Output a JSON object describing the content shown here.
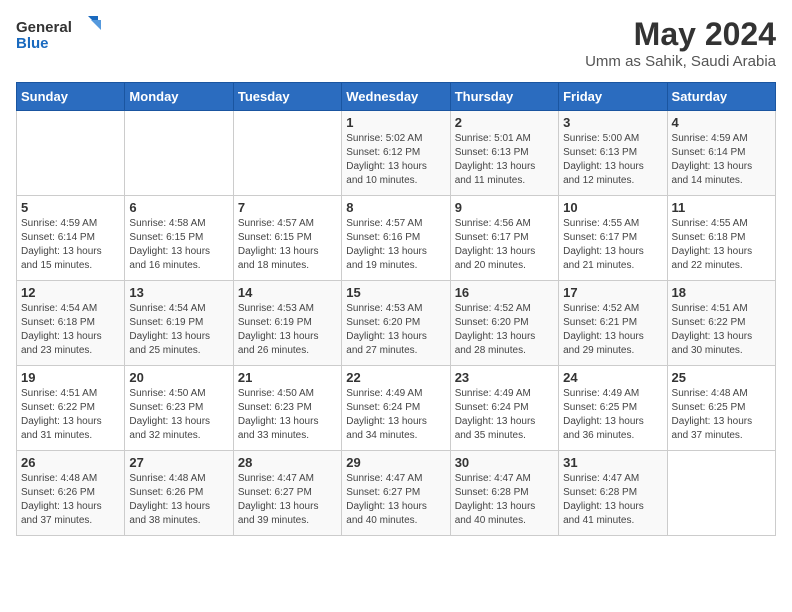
{
  "logo": {
    "general": "General",
    "blue": "Blue"
  },
  "title": "May 2024",
  "subtitle": "Umm as Sahik, Saudi Arabia",
  "days_of_week": [
    "Sunday",
    "Monday",
    "Tuesday",
    "Wednesday",
    "Thursday",
    "Friday",
    "Saturday"
  ],
  "weeks": [
    [
      {
        "day": "",
        "info": ""
      },
      {
        "day": "",
        "info": ""
      },
      {
        "day": "",
        "info": ""
      },
      {
        "day": "1",
        "info": "Sunrise: 5:02 AM\nSunset: 6:12 PM\nDaylight: 13 hours\nand 10 minutes."
      },
      {
        "day": "2",
        "info": "Sunrise: 5:01 AM\nSunset: 6:13 PM\nDaylight: 13 hours\nand 11 minutes."
      },
      {
        "day": "3",
        "info": "Sunrise: 5:00 AM\nSunset: 6:13 PM\nDaylight: 13 hours\nand 12 minutes."
      },
      {
        "day": "4",
        "info": "Sunrise: 4:59 AM\nSunset: 6:14 PM\nDaylight: 13 hours\nand 14 minutes."
      }
    ],
    [
      {
        "day": "5",
        "info": "Sunrise: 4:59 AM\nSunset: 6:14 PM\nDaylight: 13 hours\nand 15 minutes."
      },
      {
        "day": "6",
        "info": "Sunrise: 4:58 AM\nSunset: 6:15 PM\nDaylight: 13 hours\nand 16 minutes."
      },
      {
        "day": "7",
        "info": "Sunrise: 4:57 AM\nSunset: 6:15 PM\nDaylight: 13 hours\nand 18 minutes."
      },
      {
        "day": "8",
        "info": "Sunrise: 4:57 AM\nSunset: 6:16 PM\nDaylight: 13 hours\nand 19 minutes."
      },
      {
        "day": "9",
        "info": "Sunrise: 4:56 AM\nSunset: 6:17 PM\nDaylight: 13 hours\nand 20 minutes."
      },
      {
        "day": "10",
        "info": "Sunrise: 4:55 AM\nSunset: 6:17 PM\nDaylight: 13 hours\nand 21 minutes."
      },
      {
        "day": "11",
        "info": "Sunrise: 4:55 AM\nSunset: 6:18 PM\nDaylight: 13 hours\nand 22 minutes."
      }
    ],
    [
      {
        "day": "12",
        "info": "Sunrise: 4:54 AM\nSunset: 6:18 PM\nDaylight: 13 hours\nand 23 minutes."
      },
      {
        "day": "13",
        "info": "Sunrise: 4:54 AM\nSunset: 6:19 PM\nDaylight: 13 hours\nand 25 minutes."
      },
      {
        "day": "14",
        "info": "Sunrise: 4:53 AM\nSunset: 6:19 PM\nDaylight: 13 hours\nand 26 minutes."
      },
      {
        "day": "15",
        "info": "Sunrise: 4:53 AM\nSunset: 6:20 PM\nDaylight: 13 hours\nand 27 minutes."
      },
      {
        "day": "16",
        "info": "Sunrise: 4:52 AM\nSunset: 6:20 PM\nDaylight: 13 hours\nand 28 minutes."
      },
      {
        "day": "17",
        "info": "Sunrise: 4:52 AM\nSunset: 6:21 PM\nDaylight: 13 hours\nand 29 minutes."
      },
      {
        "day": "18",
        "info": "Sunrise: 4:51 AM\nSunset: 6:22 PM\nDaylight: 13 hours\nand 30 minutes."
      }
    ],
    [
      {
        "day": "19",
        "info": "Sunrise: 4:51 AM\nSunset: 6:22 PM\nDaylight: 13 hours\nand 31 minutes."
      },
      {
        "day": "20",
        "info": "Sunrise: 4:50 AM\nSunset: 6:23 PM\nDaylight: 13 hours\nand 32 minutes."
      },
      {
        "day": "21",
        "info": "Sunrise: 4:50 AM\nSunset: 6:23 PM\nDaylight: 13 hours\nand 33 minutes."
      },
      {
        "day": "22",
        "info": "Sunrise: 4:49 AM\nSunset: 6:24 PM\nDaylight: 13 hours\nand 34 minutes."
      },
      {
        "day": "23",
        "info": "Sunrise: 4:49 AM\nSunset: 6:24 PM\nDaylight: 13 hours\nand 35 minutes."
      },
      {
        "day": "24",
        "info": "Sunrise: 4:49 AM\nSunset: 6:25 PM\nDaylight: 13 hours\nand 36 minutes."
      },
      {
        "day": "25",
        "info": "Sunrise: 4:48 AM\nSunset: 6:25 PM\nDaylight: 13 hours\nand 37 minutes."
      }
    ],
    [
      {
        "day": "26",
        "info": "Sunrise: 4:48 AM\nSunset: 6:26 PM\nDaylight: 13 hours\nand 37 minutes."
      },
      {
        "day": "27",
        "info": "Sunrise: 4:48 AM\nSunset: 6:26 PM\nDaylight: 13 hours\nand 38 minutes."
      },
      {
        "day": "28",
        "info": "Sunrise: 4:47 AM\nSunset: 6:27 PM\nDaylight: 13 hours\nand 39 minutes."
      },
      {
        "day": "29",
        "info": "Sunrise: 4:47 AM\nSunset: 6:27 PM\nDaylight: 13 hours\nand 40 minutes."
      },
      {
        "day": "30",
        "info": "Sunrise: 4:47 AM\nSunset: 6:28 PM\nDaylight: 13 hours\nand 40 minutes."
      },
      {
        "day": "31",
        "info": "Sunrise: 4:47 AM\nSunset: 6:28 PM\nDaylight: 13 hours\nand 41 minutes."
      },
      {
        "day": "",
        "info": ""
      }
    ]
  ]
}
